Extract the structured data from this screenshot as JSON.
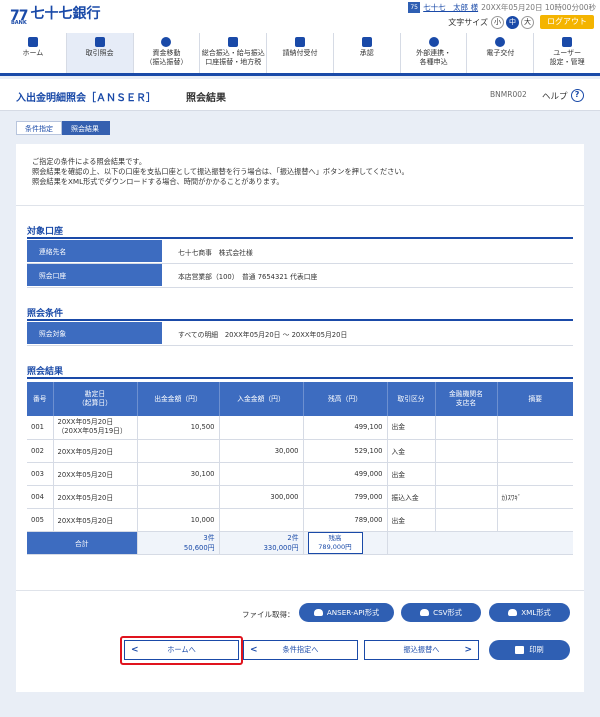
{
  "header": {
    "logo_mark": "77",
    "logo_bank": "BANK",
    "logo_text": "七十七銀行",
    "user_badge": "75",
    "user_name": "七十七　太郎 様",
    "login_time": "20XX年05月20日 10時00分00秒",
    "font_size_label": "文字サイズ",
    "font_sizes": [
      "小",
      "中",
      "大"
    ],
    "logout_label": "ログアウト"
  },
  "nav": [
    {
      "l1": "ホーム",
      "l2": ""
    },
    {
      "l1": "取引照会",
      "l2": ""
    },
    {
      "l1": "資金移動",
      "l2": "（振込振替）"
    },
    {
      "l1": "総合振込・給与振込",
      "l2": "口座振替・地方税"
    },
    {
      "l1": "請納付受付",
      "l2": ""
    },
    {
      "l1": "承認",
      "l2": ""
    },
    {
      "l1": "外部連携・",
      "l2": "各種申込"
    },
    {
      "l1": "電子交付",
      "l2": ""
    },
    {
      "l1": "ユーザー",
      "l2": "設定・管理"
    }
  ],
  "title": {
    "main": "入出金明細照会［ＡＮＳＥＲ］",
    "sub": "照会結果",
    "screen_id": "BNMR002",
    "help": "ヘルプ",
    "help_icon": "?"
  },
  "breadcrumb": [
    "条件指定",
    "照会結果"
  ],
  "intro": [
    "ご指定の条件による照会結果です。",
    "照会結果を確認の上、以下の口座を支払口座として振込振替を行う場合は、「振込振替へ」ボタンを押してください。",
    "照会結果をXML形式でダウンロードする場合、時間がかかることがあります。"
  ],
  "account_section": {
    "title": "対象口座",
    "rows": [
      {
        "k": "連絡先名",
        "v": "七十七商事　株式会社様"
      },
      {
        "k": "照会口座",
        "v": "本店営業部（100）　普通 7654321 代表口座"
      }
    ]
  },
  "condition_section": {
    "title": "照会条件",
    "rows": [
      {
        "k": "照会対象",
        "v": "すべての明細　20XX年05月20日 ～ 20XX年05月20日"
      }
    ]
  },
  "result_section": {
    "title": "照会結果",
    "headers": [
      "番号",
      "勘定日",
      "（起算日）",
      "出金金額（円）",
      "入金金額（円）",
      "残高（円）",
      "取引区分",
      "金融機関名",
      "支店名",
      "摘要"
    ],
    "rows": [
      {
        "no": "001",
        "date": "20XX年05月20日",
        "date2": "（20XX年05月19日）",
        "out": "10,500",
        "in": "",
        "bal": "499,100",
        "type": "出金",
        "bank": "",
        "memo": ""
      },
      {
        "no": "002",
        "date": "20XX年05月20日",
        "date2": "",
        "out": "",
        "in": "30,000",
        "bal": "529,100",
        "type": "入金",
        "bank": "",
        "memo": ""
      },
      {
        "no": "003",
        "date": "20XX年05月20日",
        "date2": "",
        "out": "30,100",
        "in": "",
        "bal": "499,000",
        "type": "出金",
        "bank": "",
        "memo": ""
      },
      {
        "no": "004",
        "date": "20XX年05月20日",
        "date2": "",
        "out": "",
        "in": "300,000",
        "bal": "799,000",
        "type": "振込入金",
        "bank": "",
        "memo": "ｶ)ｽﾜｷﾞ"
      },
      {
        "no": "005",
        "date": "20XX年05月20日",
        "date2": "",
        "out": "10,000",
        "in": "",
        "bal": "789,000",
        "type": "出金",
        "bank": "",
        "memo": ""
      }
    ],
    "total": {
      "label": "合計",
      "out_count": "3件",
      "out_sum": "50,600円",
      "in_count": "2件",
      "in_sum": "330,000円",
      "bal_label": "残高",
      "bal_value": "789,000円"
    }
  },
  "download": {
    "label": "ファイル取得：",
    "buttons": [
      "ANSER-API形式",
      "CSV形式",
      "XML形式"
    ]
  },
  "actions": {
    "home": "ホームへ",
    "condition": "条件指定へ",
    "transfer": "振込振替へ",
    "print": "印刷"
  }
}
